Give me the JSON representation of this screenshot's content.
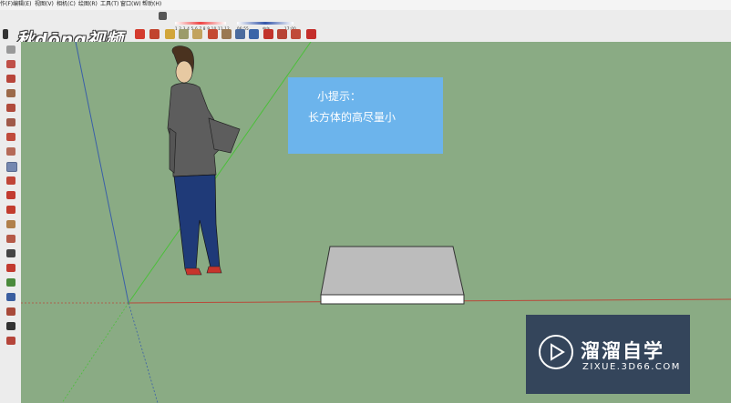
{
  "menu": [
    "作(F)",
    "编辑(E)",
    "视图(V)",
    "相机(C)",
    "绘图(R)",
    "工具(T)",
    "窗口(W)",
    "帮助(H)"
  ],
  "logo_text": "秋dōng视频",
  "shadow_panel": {
    "months": "1 2 3 4 5 6 7 8 9 10 11 12",
    "time_left": "06:55",
    "time_mid": "中午",
    "time_right": "17:00"
  },
  "tip": {
    "title": "小提示：",
    "text": "长方体的高尽量小"
  },
  "watermark": {
    "name": "溜溜自学",
    "url": "ZIXUE.3D66.COM"
  },
  "colors": {
    "viewport": "#8aab84",
    "tip_box": "#6cb4ec",
    "watermark_bg": "#2d3c58",
    "red_axis": "#b84a3a",
    "green_axis": "#4bbf3a",
    "blue_axis": "#3a5fa8"
  }
}
